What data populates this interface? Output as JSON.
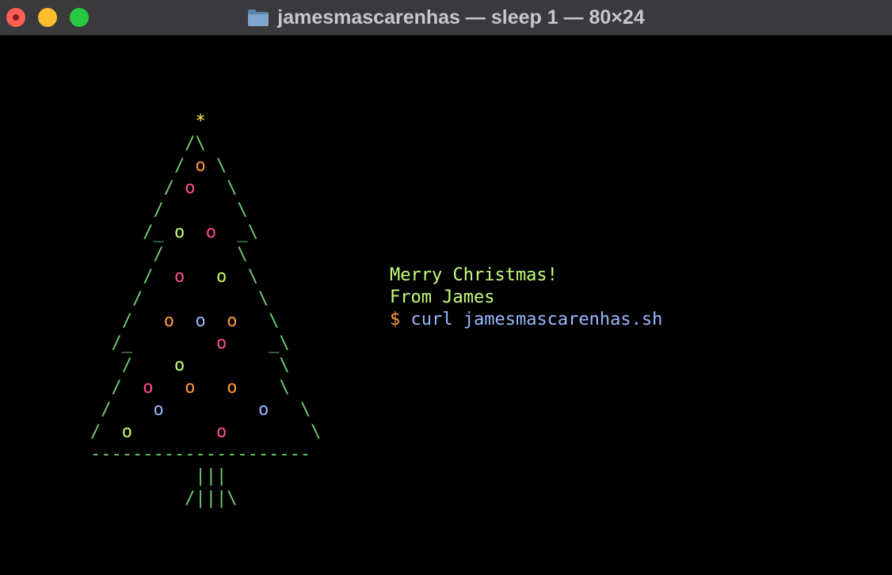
{
  "window": {
    "title": "jamesmascarenhas — sleep 1 — 80×24",
    "folder_icon": "folder-icon"
  },
  "terminal": {
    "message_line1": "Merry Christmas!",
    "message_line2": "From James",
    "prompt_symbol": "$",
    "command": "curl jamesmascarenhas.sh"
  },
  "tree": {
    "star": "*",
    "ground": "---------------------",
    "trunk_top": "|||",
    "trunk_base": "/|||\\",
    "colors": {
      "trunk": "#6fd06c",
      "star": "#fff35a",
      "orange": "#ff9a3d",
      "pink": "#ff4d8d",
      "lime": "#c6ff6a",
      "blue": "#9ab8ff"
    }
  }
}
